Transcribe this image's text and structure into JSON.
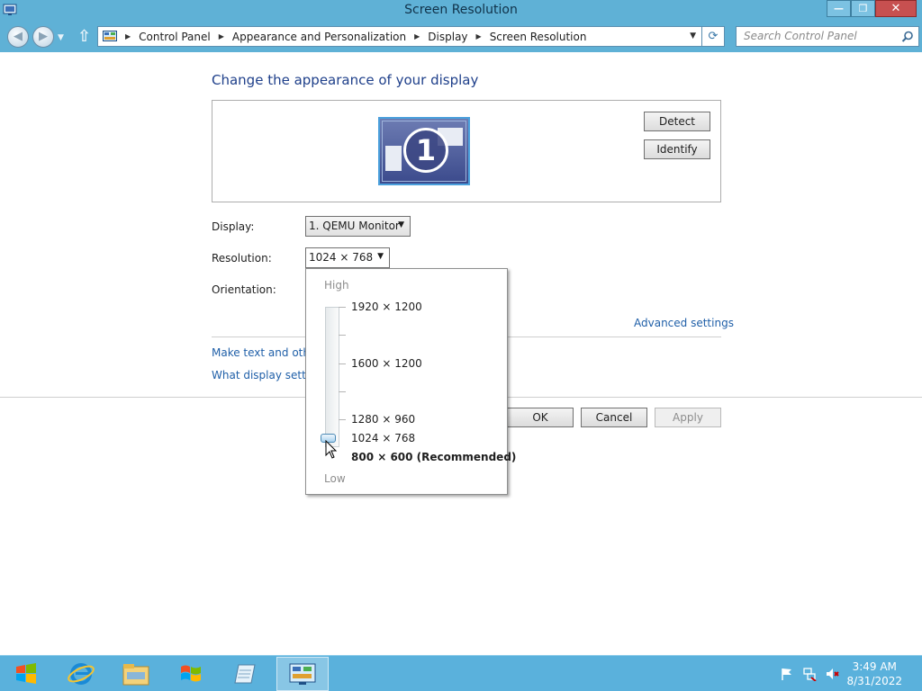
{
  "window": {
    "title": "Screen Resolution"
  },
  "window_controls": {
    "minimize": "—",
    "maximize": "❐",
    "close": "✕"
  },
  "address_bar": {
    "breadcrumbs": [
      "Control Panel",
      "Appearance and Personalization",
      "Display",
      "Screen Resolution"
    ]
  },
  "search": {
    "placeholder": "Search Control Panel"
  },
  "main": {
    "heading": "Change the appearance of your display",
    "monitor_number": "1",
    "detect_label": "Detect",
    "identify_label": "Identify",
    "display_label": "Display:",
    "display_value": "1. QEMU Monitor",
    "resolution_label": "Resolution:",
    "resolution_value": "1024 × 768",
    "orientation_label": "Orientation:",
    "advanced_link": "Advanced settings",
    "link_text_size": "Make text and other",
    "link_display_settings": "What display setting"
  },
  "resolution_popup": {
    "high_label": "High",
    "low_label": "Low",
    "options": [
      "1920 × 1200",
      "1600 × 1200",
      "1280 × 960",
      "1024 × 768",
      "800 × 600 (Recommended)"
    ],
    "selected": "1024 × 768"
  },
  "dialog_buttons": {
    "ok": "OK",
    "cancel": "Cancel",
    "apply": "Apply"
  },
  "taskbar": {
    "items": [
      "start",
      "internet-explorer",
      "file-explorer",
      "windows-flag",
      "notepad",
      "control-panel"
    ],
    "clock_time": "3:49 AM",
    "clock_date": "8/31/2022"
  },
  "colors": {
    "titlebar": "#5fb1d6",
    "taskbar": "#5ab1dc",
    "heading": "#1e3f8a",
    "link": "#1f5fa8"
  }
}
